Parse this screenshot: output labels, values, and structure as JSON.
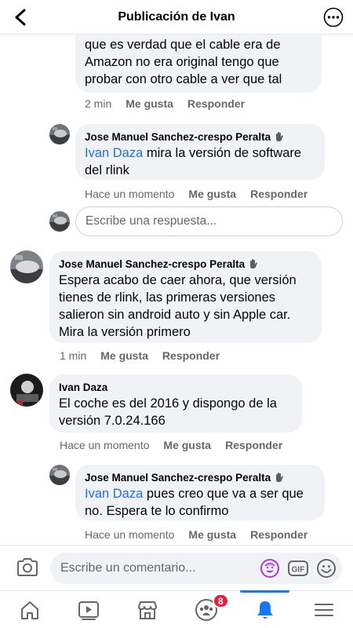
{
  "header": {
    "title": "Publicación de Ivan",
    "back_icon": "chevron-left-icon",
    "more_icon": "more-options-icon"
  },
  "comments": [
    {
      "text": "que es verdad que el cable era de Amazon no era original tengo que probar con otro cable a ver que tal",
      "lines": [
        "que es verdad que el cable era de",
        "Amazon no era original tengo que",
        "probar con otro cable a ver que tal"
      ],
      "time": "2 min",
      "like": "Me gusta",
      "reply": "Responder"
    },
    {
      "author": "Jose Manuel Sanchez-crespo Peralta",
      "mention": "Ivan Daza",
      "line1_rest": " mira la versión de software",
      "line2": "del rlink",
      "time": "Hace un momento",
      "like": "Me gusta",
      "reply": "Responder"
    },
    {
      "author": "Jose Manuel Sanchez-crespo Peralta",
      "lines": [
        "Espera acabo de caer ahora, que versión",
        "tienes de rlink, las primeras versiones",
        "salieron sin android auto y sin Apple car.",
        "Mira la versión primero"
      ],
      "time": "1 min",
      "like": "Me gusta",
      "reply": "Responder"
    },
    {
      "author": "Ivan Daza",
      "lines": [
        "El coche es del 2016 y dispongo de la",
        "versión 7.0.24.166"
      ],
      "time": "Hace un momento",
      "like": "Me gusta",
      "reply": "Responder"
    },
    {
      "author": "Jose Manuel Sanchez-crespo Peralta",
      "mention": "Ivan Daza",
      "line1_rest": " pues creo que va a ser que",
      "line2": "no. Espera te lo confirmo",
      "time": "Hace un momento",
      "like": "Me gusta",
      "reply": "Responder"
    }
  ],
  "reply_input": {
    "placeholder": "Escribe una respuesta..."
  },
  "comment_bar": {
    "placeholder": "Escribe un comentario...",
    "gif_label": "GIF"
  },
  "tabs": [
    {
      "icon": "home-icon",
      "active": false
    },
    {
      "icon": "video-icon",
      "active": false
    },
    {
      "icon": "marketplace-icon",
      "active": false
    },
    {
      "icon": "groups-icon",
      "active": false,
      "badge": "8"
    },
    {
      "icon": "notifications-icon",
      "active": true
    },
    {
      "icon": "menu-icon",
      "active": false
    }
  ],
  "colors": {
    "accent": "#1877f2",
    "mention": "#216fdb",
    "badge": "#e41e3f",
    "bubble": "#f0f2f5",
    "meta": "#65676b"
  }
}
